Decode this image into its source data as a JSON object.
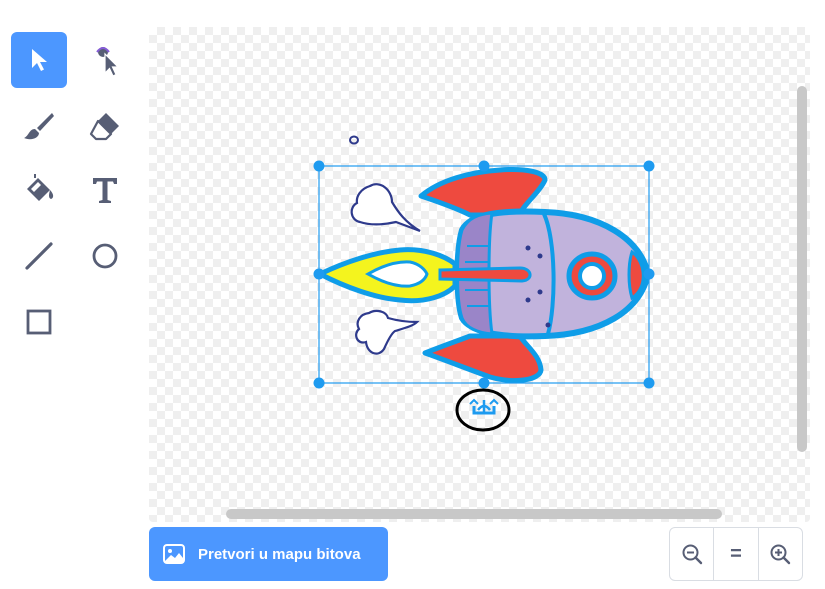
{
  "tools": [
    {
      "name": "select-tool",
      "icon": "arrow-pointer-icon",
      "selected": true
    },
    {
      "name": "reshape-tool",
      "icon": "reshape-pointer-icon",
      "selected": false
    },
    {
      "name": "brush-tool",
      "icon": "brush-icon",
      "selected": false
    },
    {
      "name": "eraser-tool",
      "icon": "eraser-icon",
      "selected": false
    },
    {
      "name": "fill-tool",
      "icon": "paint-bucket-icon",
      "selected": false
    },
    {
      "name": "text-tool",
      "icon": "text-T-icon",
      "selected": false
    },
    {
      "name": "line-tool",
      "icon": "line-icon",
      "selected": false
    },
    {
      "name": "circle-tool",
      "icon": "circle-icon",
      "selected": false
    },
    {
      "name": "rectangle-tool",
      "icon": "square-icon",
      "selected": false
    }
  ],
  "canvas": {
    "sprite": "rocket",
    "background": "transparent-checkerboard",
    "selection": "rotation-handle-circled"
  },
  "convert_button": {
    "label": "Pretvori u mapu bitova",
    "icon": "image-icon"
  },
  "zoom": {
    "out_icon": "zoom-out-icon",
    "reset_label": "=",
    "in_icon": "zoom-in-icon"
  },
  "colors": {
    "accent": "#4c97ff",
    "selection": "#1e9bf0",
    "rocket_outline": "#0f9de8",
    "rocket_red": "#ee4a3f",
    "rocket_body": "#c1b3dc",
    "flame": "#f4f41e"
  }
}
